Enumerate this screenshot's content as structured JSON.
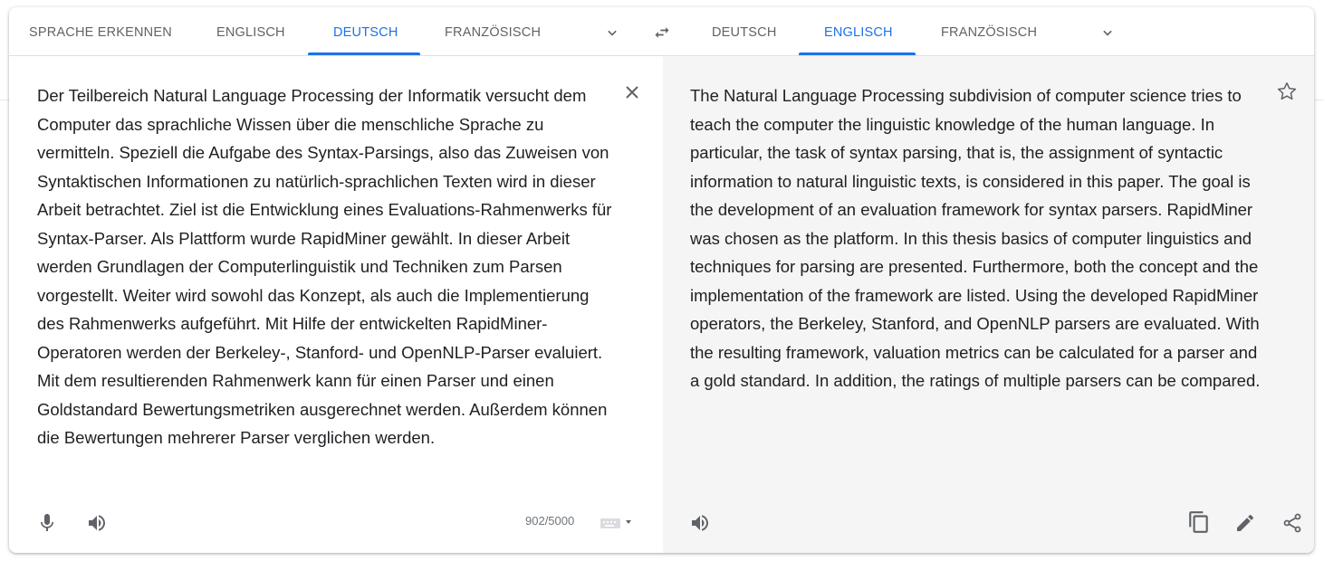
{
  "source_tabs": [
    {
      "label": "SPRACHE ERKENNEN",
      "active": false
    },
    {
      "label": "ENGLISCH",
      "active": false
    },
    {
      "label": "DEUTSCH",
      "active": true
    },
    {
      "label": "FRANZÖSISCH",
      "active": false
    }
  ],
  "target_tabs": [
    {
      "label": "DEUTSCH",
      "active": false
    },
    {
      "label": "ENGLISCH",
      "active": true
    },
    {
      "label": "FRANZÖSISCH",
      "active": false
    }
  ],
  "source": {
    "text": "Der Teilbereich Natural Language Processing der Informatik versucht dem Computer das sprachliche Wissen über die menschliche Sprache zu vermitteln. Speziell die Aufgabe des Syntax-Parsings, also das Zuweisen von Syntaktischen Informationen zu natürlich-sprachlichen Texten wird in dieser Arbeit betrachtet. Ziel ist die Entwicklung eines Evaluations-Rahmenwerks für Syntax-Parser. Als Plattform wurde RapidMiner gewählt. In dieser Arbeit werden Grundlagen der Computerlinguistik und Techniken zum Parsen vorgestellt. Weiter wird sowohl das Konzept, als auch die Implementierung des Rahmenwerks aufgeführt. Mit Hilfe der entwickelten RapidMiner-Operatoren werden der Berkeley-, Stanford- und OpenNLP-Parser evaluiert. Mit dem resultierenden Rahmenwerk kann für einen Parser und einen Goldstandard Bewertungsmetriken ausgerechnet werden. Außerdem können die Bewertungen mehrerer Parser verglichen werden.",
    "char_count": "902/5000"
  },
  "target": {
    "text": "The Natural Language Processing subdivision of computer science tries to teach the computer the linguistic knowledge of the human language. In particular, the task of syntax parsing, that is, the assignment of syntactic information to natural linguistic texts, is considered in this paper. The goal is the development of an evaluation framework for syntax parsers. RapidMiner was chosen as the platform. In this thesis basics of computer linguistics and techniques for parsing are presented. Furthermore, both the concept and the implementation of the framework are listed. Using the developed RapidMiner operators, the Berkeley, Stanford, and OpenNLP parsers are evaluated. With the resulting framework, valuation metrics can be calculated for a parser and a gold standard. In addition, the ratings of multiple parsers can be compared."
  },
  "colors": {
    "accent": "#1a73e8",
    "tab_text": "#5f6368",
    "icon": "#5f6368",
    "target_bg": "#f5f5f5"
  },
  "icons": [
    "chevron-down-icon",
    "swap-icon",
    "close-icon",
    "star-icon",
    "microphone-icon",
    "speaker-icon",
    "keyboard-icon",
    "copy-icon",
    "edit-icon",
    "share-icon"
  ]
}
